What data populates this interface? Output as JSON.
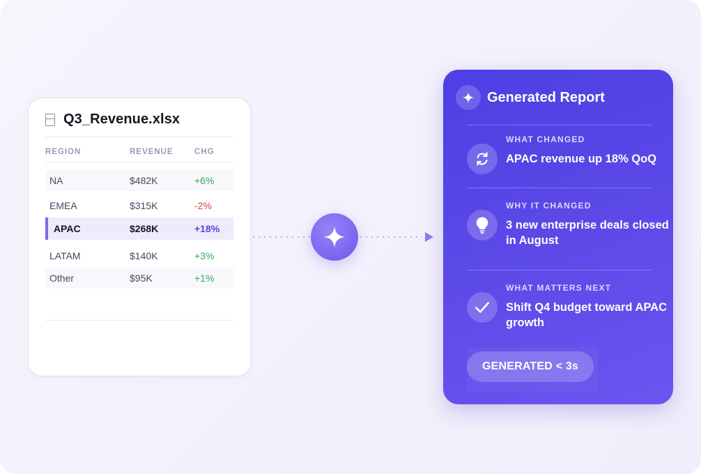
{
  "spreadsheet": {
    "filename": "Q3_Revenue.xlsx",
    "file_icon": "spreadsheet-file-icon",
    "columns": [
      "REGION",
      "REVENUE",
      "CHG"
    ],
    "rows": [
      {
        "region": "NA",
        "revenue": "$482K",
        "change": "+6%"
      },
      {
        "region": "EMEA",
        "revenue": "$315K",
        "change": "-2%"
      },
      {
        "region": "APAC",
        "revenue": "$268K",
        "change": "+18%"
      },
      {
        "region": "LATAM",
        "revenue": "$140K",
        "change": "+3%"
      },
      {
        "region": "Other",
        "revenue": "$95K",
        "change": "+1%"
      }
    ]
  },
  "connector": {
    "icon": "sparkle-icon"
  },
  "report": {
    "title": "Generated Report",
    "title_icon": "sparkle-icon",
    "sections": [
      {
        "label": "WHAT CHANGED",
        "body": "APAC revenue up 18% QoQ",
        "icon": "refresh-icon"
      },
      {
        "label": "WHY IT CHANGED",
        "body": "3 new enterprise deals closed in August",
        "icon": "lightbulb-icon"
      },
      {
        "label": "WHAT MATTERS NEXT",
        "body": "Shift Q4 budget toward APAC growth",
        "icon": "checkmark-icon"
      }
    ],
    "badge": "GENERATED < 3s"
  },
  "colors": {
    "accent": "#5a43dc",
    "positive": "#35a85c",
    "negative": "#e0453d",
    "report_bg": "#5a48e7"
  }
}
